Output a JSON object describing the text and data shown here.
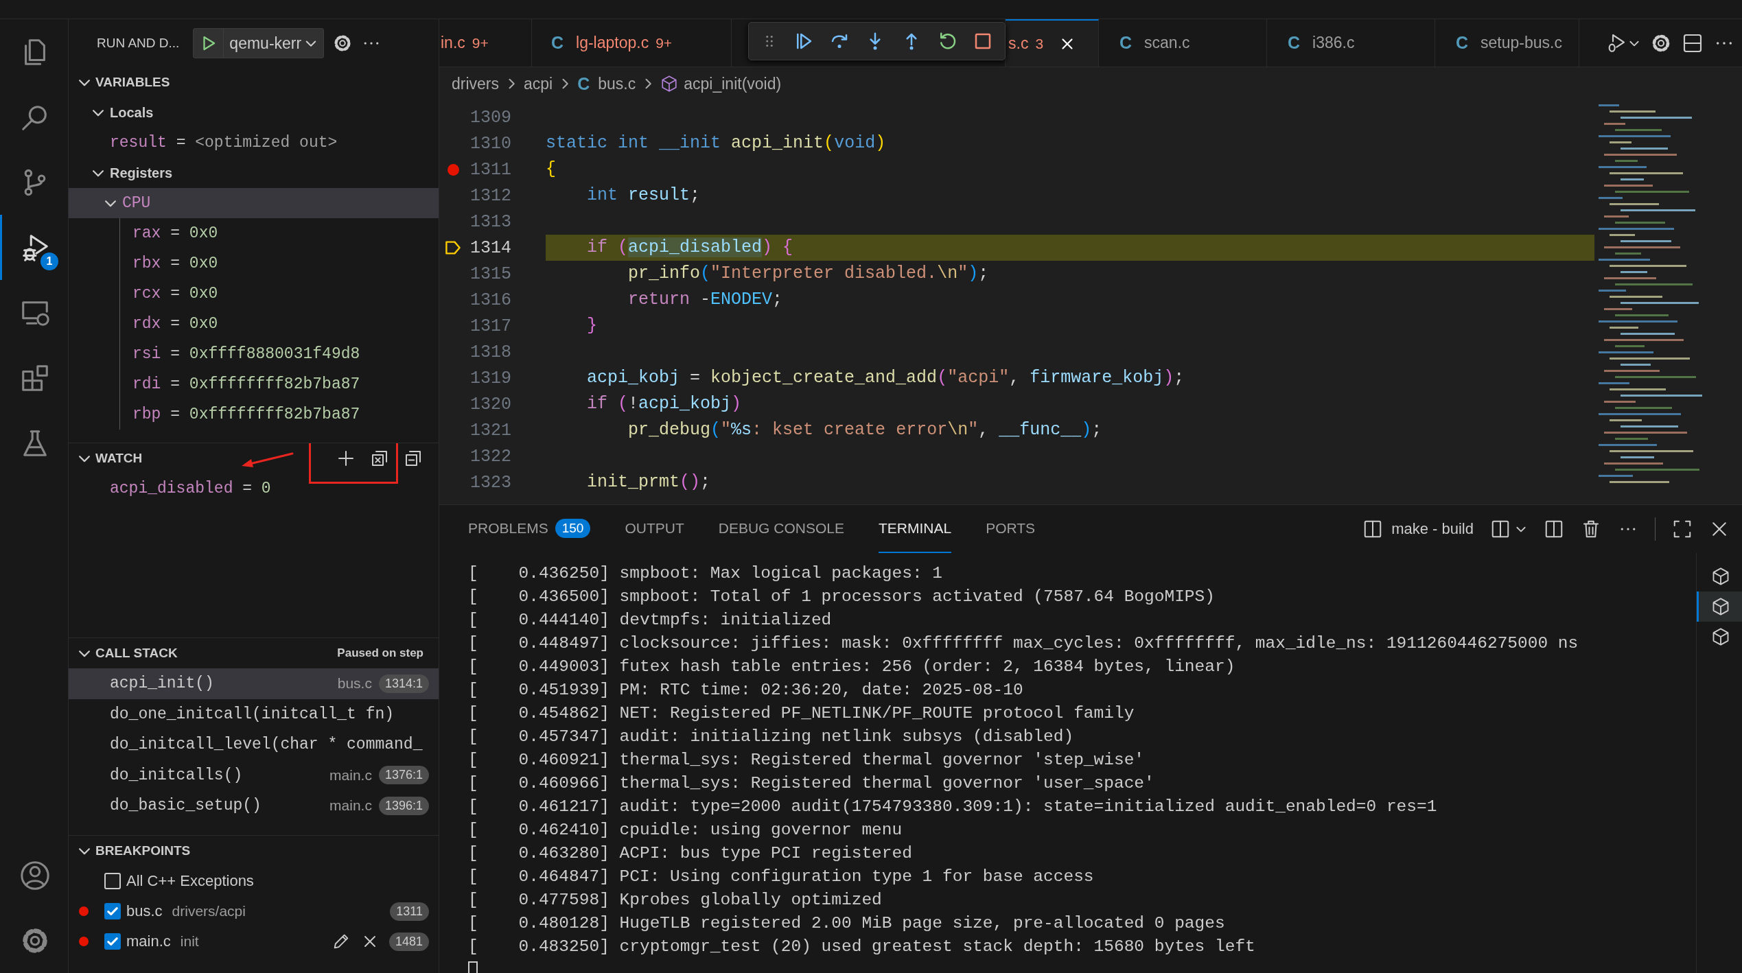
{
  "activity_bar": {
    "top": [
      {
        "kind": "explorer",
        "selected": false
      },
      {
        "kind": "search",
        "selected": false
      },
      {
        "kind": "source-control",
        "selected": false
      },
      {
        "kind": "run-debug",
        "selected": true,
        "badge": "1"
      },
      {
        "kind": "remote",
        "selected": false
      },
      {
        "kind": "extensions",
        "selected": false
      },
      {
        "kind": "testing",
        "selected": false
      }
    ],
    "bottom": [
      {
        "kind": "account",
        "selected": false
      },
      {
        "kind": "settings",
        "selected": false
      }
    ]
  },
  "sidebar": {
    "title": "RUN AND D...",
    "config": "qemu-kerr",
    "variables": {
      "title": "VARIABLES",
      "expanded": true,
      "scopes": [
        {
          "label": "Locals",
          "expanded": true,
          "items": [
            {
              "name": "result",
              "operator": "=",
              "value": "<optimized out>",
              "kind": "unavailable"
            }
          ]
        },
        {
          "label": "Registers",
          "expanded": true,
          "groups": [
            {
              "label": "CPU",
              "expanded": true,
              "selected": true,
              "items": [
                {
                  "name": "rax",
                  "operator": "=",
                  "value": "0x0",
                  "kind": "number"
                },
                {
                  "name": "rbx",
                  "operator": "=",
                  "value": "0x0",
                  "kind": "number"
                },
                {
                  "name": "rcx",
                  "operator": "=",
                  "value": "0x0",
                  "kind": "number"
                },
                {
                  "name": "rdx",
                  "operator": "=",
                  "value": "0x0",
                  "kind": "number"
                },
                {
                  "name": "rsi",
                  "operator": "=",
                  "value": "0xffff8880031f49d8",
                  "kind": "number"
                },
                {
                  "name": "rdi",
                  "operator": "=",
                  "value": "0xffffffff82b7ba87",
                  "kind": "number"
                },
                {
                  "name": "rbp",
                  "operator": "=",
                  "value": "0xffffffff82b7ba87",
                  "kind": "number"
                }
              ]
            }
          ]
        }
      ]
    },
    "watch": {
      "title": "WATCH",
      "expanded": true,
      "items": [
        {
          "name": "acpi_disabled",
          "operator": "=",
          "value": "0",
          "kind": "number"
        }
      ]
    },
    "call_stack": {
      "title": "CALL STACK",
      "expanded": true,
      "status": "Paused on step",
      "frames": [
        {
          "name": "acpi_init()",
          "file": "bus.c",
          "position": "1314:1",
          "selected": true
        },
        {
          "name": "do_one_initcall(initcall_t fn)",
          "selected": false
        },
        {
          "name": "do_initcall_level(char * command_",
          "selected": false
        },
        {
          "name": "do_initcalls()",
          "file": "main.c",
          "position": "1376:1",
          "selected": false
        },
        {
          "name": "do_basic_setup()",
          "file": "main.c",
          "position": "1396:1",
          "selected": false
        }
      ]
    },
    "breakpoints": {
      "title": "BREAKPOINTS",
      "expanded": true,
      "items": [
        {
          "kind": "exception",
          "label": "All C++ Exceptions",
          "checked": false,
          "hovered": false
        },
        {
          "kind": "file",
          "label": "bus.c",
          "path": "drivers/acpi",
          "line": "1311",
          "checked": true,
          "hovered": false
        },
        {
          "kind": "file",
          "label": "main.c",
          "path": "init",
          "line": "1481",
          "checked": true,
          "hovered": true
        }
      ]
    }
  },
  "editor": {
    "tabs": [
      {
        "label": "in.c",
        "problems": "9+",
        "selected": false
      },
      {
        "icon": "C",
        "label": "lg-laptop.c",
        "problems": "9+",
        "selected": false
      },
      {
        "label": "s.c",
        "problems": "3",
        "selected": true
      },
      {
        "icon": "C",
        "label": "scan.c",
        "selected": false
      },
      {
        "icon": "C",
        "label": "i386.c",
        "selected": false
      },
      {
        "icon": "C",
        "label": "setup-bus.c",
        "selected": false
      }
    ],
    "breadcrumbs": [
      {
        "label": "drivers",
        "kind": "folder"
      },
      {
        "label": "acpi",
        "kind": "folder"
      },
      {
        "icon": "C",
        "label": "bus.c",
        "kind": "c-file"
      },
      {
        "label": "acpi_init(void)",
        "kind": "function"
      }
    ],
    "lines": [
      {
        "number": "1309",
        "breakpoint": false,
        "current": false
      },
      {
        "number": "1310",
        "breakpoint": false,
        "current": false,
        "tokens": [
          {
            "t": "static ",
            "kind": "kw"
          },
          {
            "t": "int ",
            "kind": "kw"
          },
          {
            "t": "__init ",
            "kind": "kw"
          },
          {
            "t": "acpi_init",
            "kind": "fn"
          },
          {
            "t": "(",
            "kind": "b1"
          },
          {
            "t": "void",
            "kind": "kw"
          },
          {
            "t": ")",
            "kind": "b1"
          }
        ]
      },
      {
        "number": "1311",
        "breakpoint": true,
        "current": false,
        "tokens": [
          {
            "t": "{",
            "kind": "b1"
          }
        ]
      },
      {
        "number": "1312",
        "breakpoint": false,
        "current": false,
        "tokens": [
          {
            "t": "    int ",
            "kind": "kw"
          },
          {
            "t": "result",
            "kind": "var"
          },
          {
            "t": ";",
            "kind": "p"
          }
        ]
      },
      {
        "number": "1313",
        "breakpoint": false,
        "current": false
      },
      {
        "number": "1314",
        "breakpoint": false,
        "current": true,
        "tokens": [
          {
            "t": "    if ",
            "kind": "ctl"
          },
          {
            "t": "(",
            "kind": "b2"
          },
          {
            "t": "acpi_disabled",
            "kind": "match"
          },
          {
            "t": ")",
            "kind": "b2"
          },
          {
            "t": " {",
            "kind": "b2"
          }
        ]
      },
      {
        "number": "1315",
        "breakpoint": false,
        "current": false,
        "tokens": [
          {
            "t": "        pr_info",
            "kind": "fn"
          },
          {
            "t": "(",
            "kind": "b3"
          },
          {
            "t": "\"Interpreter disabled.",
            "kind": "str"
          },
          {
            "t": "\\n",
            "kind": "esc"
          },
          {
            "t": "\"",
            "kind": "str"
          },
          {
            "t": ")",
            "kind": "b3"
          },
          {
            "t": ";",
            "kind": "p"
          }
        ]
      },
      {
        "number": "1316",
        "breakpoint": false,
        "current": false,
        "tokens": [
          {
            "t": "        return ",
            "kind": "ctl"
          },
          {
            "t": "-",
            "kind": "p"
          },
          {
            "t": "ENODEV",
            "kind": "mac"
          },
          {
            "t": ";",
            "kind": "p"
          }
        ]
      },
      {
        "number": "1317",
        "breakpoint": false,
        "current": false,
        "tokens": [
          {
            "t": "    }",
            "kind": "b2"
          }
        ]
      },
      {
        "number": "1318",
        "breakpoint": false,
        "current": false
      },
      {
        "number": "1319",
        "breakpoint": false,
        "current": false,
        "tokens": [
          {
            "t": "    acpi_kobj",
            "kind": "var"
          },
          {
            "t": " = ",
            "kind": "p"
          },
          {
            "t": "kobject_create_and_add",
            "kind": "fn"
          },
          {
            "t": "(",
            "kind": "b2"
          },
          {
            "t": "\"acpi\"",
            "kind": "str"
          },
          {
            "t": ", ",
            "kind": "p"
          },
          {
            "t": "firmware_kobj",
            "kind": "var"
          },
          {
            "t": ")",
            "kind": "b2"
          },
          {
            "t": ";",
            "kind": "p"
          }
        ]
      },
      {
        "number": "1320",
        "breakpoint": false,
        "current": false,
        "tokens": [
          {
            "t": "    if ",
            "kind": "ctl"
          },
          {
            "t": "(",
            "kind": "b2"
          },
          {
            "t": "!",
            "kind": "p"
          },
          {
            "t": "acpi_kobj",
            "kind": "var"
          },
          {
            "t": ")",
            "kind": "b2"
          }
        ]
      },
      {
        "number": "1321",
        "breakpoint": false,
        "current": false,
        "tokens": [
          {
            "t": "        pr_debug",
            "kind": "fn"
          },
          {
            "t": "(",
            "kind": "b3"
          },
          {
            "t": "\"",
            "kind": "str"
          },
          {
            "t": "%s",
            "kind": "var"
          },
          {
            "t": ": kset create error",
            "kind": "str"
          },
          {
            "t": "\\n",
            "kind": "esc"
          },
          {
            "t": "\"",
            "kind": "str"
          },
          {
            "t": ", ",
            "kind": "p"
          },
          {
            "t": "__func__",
            "kind": "var"
          },
          {
            "t": ")",
            "kind": "b3"
          },
          {
            "t": ";",
            "kind": "p"
          }
        ]
      },
      {
        "number": "1322",
        "breakpoint": false,
        "current": false
      },
      {
        "number": "1323",
        "breakpoint": false,
        "current": false,
        "tokens": [
          {
            "t": "    init_prmt",
            "kind": "fn"
          },
          {
            "t": "(",
            "kind": "b2"
          },
          {
            "t": ")",
            "kind": "b2"
          },
          {
            "t": ";",
            "kind": "p"
          }
        ]
      }
    ]
  },
  "panel": {
    "tabs": [
      {
        "label": "PROBLEMS",
        "badge": "150",
        "selected": false
      },
      {
        "label": "OUTPUT",
        "selected": false
      },
      {
        "label": "DEBUG CONSOLE",
        "selected": false
      },
      {
        "label": "TERMINAL",
        "selected": true
      },
      {
        "label": "PORTS",
        "selected": false
      }
    ],
    "terminal_name": "make - build",
    "terminal_lines": [
      "[    0.436250] smpboot: Max logical packages: 1",
      "[    0.436500] smpboot: Total of 1 processors activated (7587.64 BogoMIPS)",
      "[    0.444140] devtmpfs: initialized",
      "[    0.448497] clocksource: jiffies: mask: 0xffffffff max_cycles: 0xffffffff, max_idle_ns: 1911260446275000 ns",
      "[    0.449003] futex hash table entries: 256 (order: 2, 16384 bytes, linear)",
      "[    0.451939] PM: RTC time: 02:36:20, date: 2025-08-10",
      "[    0.454862] NET: Registered PF_NETLINK/PF_ROUTE protocol family",
      "[    0.457347] audit: initializing netlink subsys (disabled)",
      "[    0.460921] thermal_sys: Registered thermal governor 'step_wise'",
      "[    0.460966] thermal_sys: Registered thermal governor 'user_space'",
      "[    0.461217] audit: type=2000 audit(1754793380.309:1): state=initialized audit_enabled=0 res=1",
      "[    0.462410] cpuidle: using governor menu",
      "[    0.463280] ACPI: bus type PCI registered",
      "[    0.464847] PCI: Using configuration type 1 for base access",
      "[    0.477598] Kprobes globally optimized",
      "[    0.480128] HugeTLB registered 2.00 MiB page size, pre-allocated 0 pages",
      "[    0.483250] cryptomgr_test (20) used greatest stack depth: 15680 bytes left"
    ],
    "terminals": [
      {
        "selected": false
      },
      {
        "selected": true
      },
      {
        "selected": false
      }
    ]
  }
}
